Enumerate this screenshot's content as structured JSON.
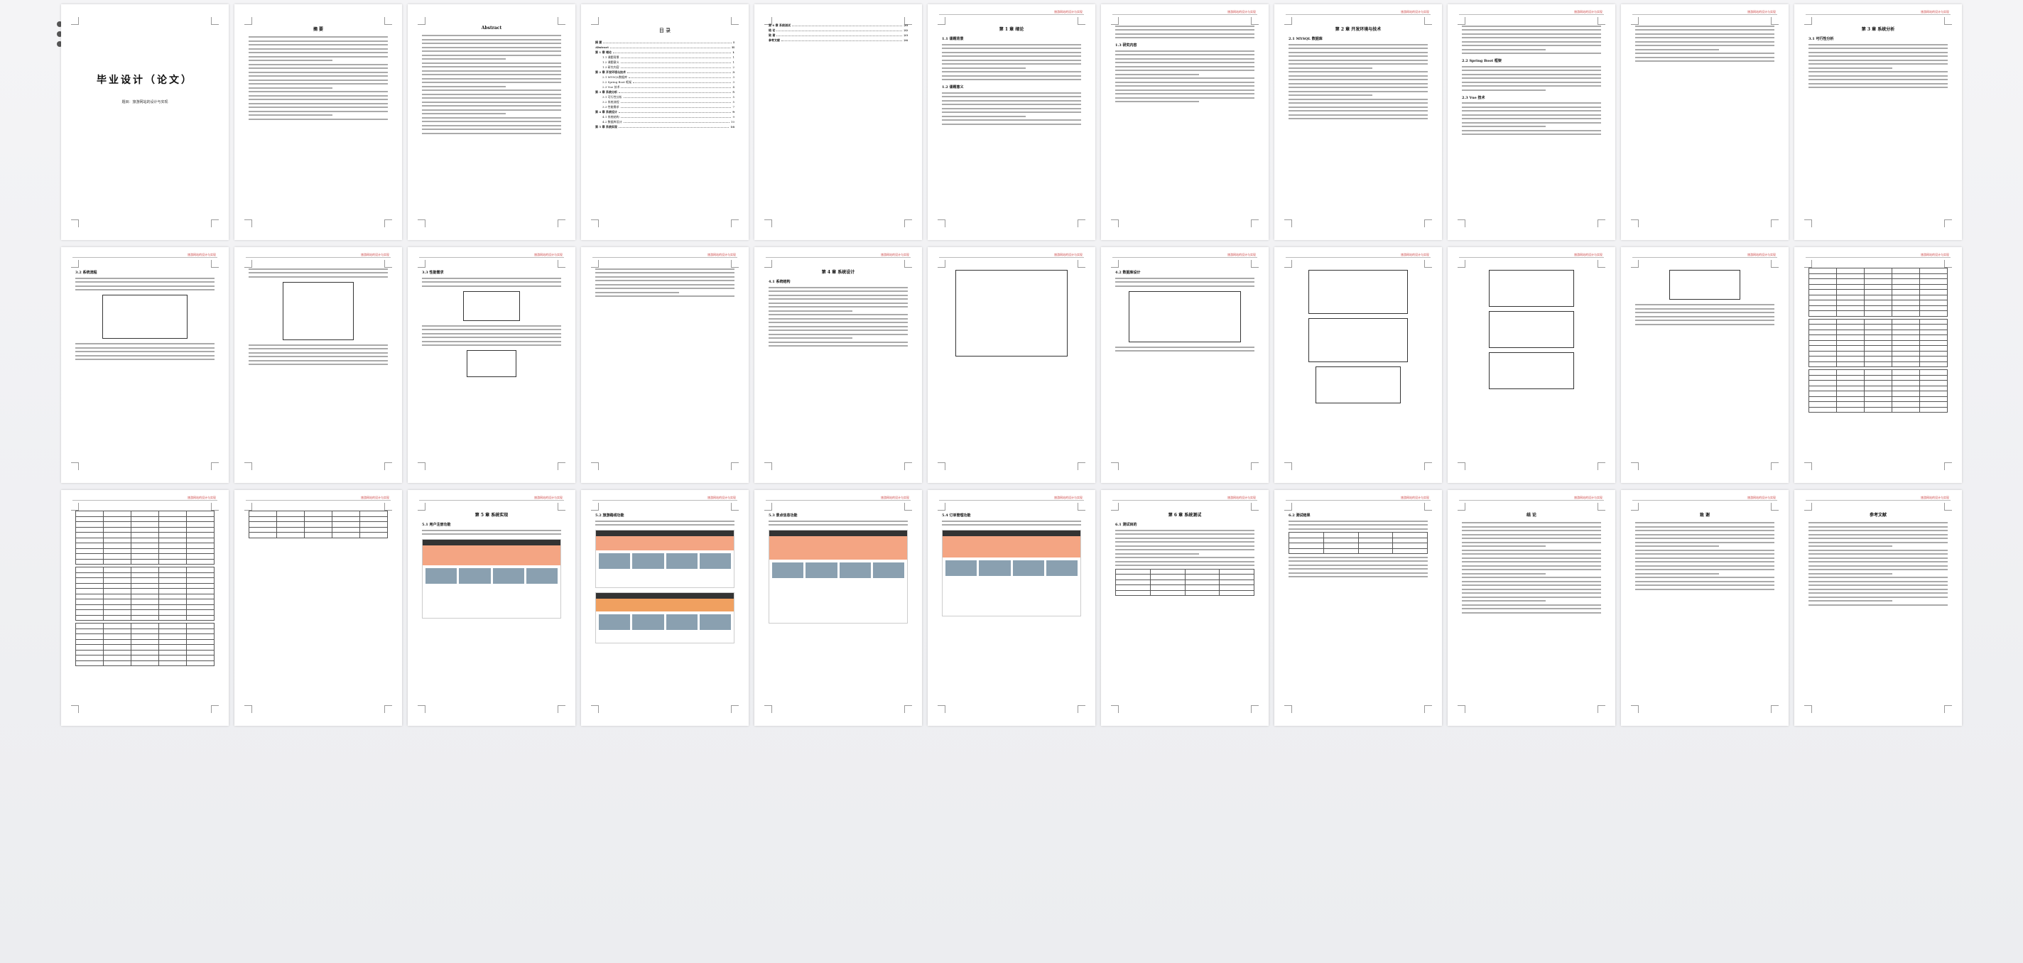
{
  "document": {
    "cover_title": "毕业设计（论文）",
    "cover_subtitle": "题目：旅游网站的设计与实现",
    "abstract_cn_title": "摘 要",
    "abstract_en_title": "Abstract",
    "toc_title": "目 录",
    "toc_entries": [
      {
        "label": "摘 要",
        "page": "I",
        "level": 1
      },
      {
        "label": "Abstract",
        "page": "II",
        "level": 1
      },
      {
        "label": "第 1 章 绪论",
        "page": "1",
        "level": 1
      },
      {
        "label": "1.1 课题背景",
        "page": "1",
        "level": 2
      },
      {
        "label": "1.2 课题意义",
        "page": "1",
        "level": 2
      },
      {
        "label": "1.3 研究内容",
        "page": "2",
        "level": 2
      },
      {
        "label": "第 2 章 开发环境与技术",
        "page": "3",
        "level": 1
      },
      {
        "label": "2.1 MYSQL数据库",
        "page": "3",
        "level": 2
      },
      {
        "label": "2.2 Spring Boot 框架",
        "page": "3",
        "level": 2
      },
      {
        "label": "2.3 Vue 技术",
        "page": "4",
        "level": 2
      },
      {
        "label": "第 3 章 系统分析",
        "page": "5",
        "level": 1
      },
      {
        "label": "3.1 可行性分析",
        "page": "5",
        "level": 2
      },
      {
        "label": "3.2 系统流程",
        "page": "5",
        "level": 2
      },
      {
        "label": "3.3 性能需求",
        "page": "7",
        "level": 2
      },
      {
        "label": "第 4 章 系统设计",
        "page": "9",
        "level": 1
      },
      {
        "label": "4.1 系统结构",
        "page": "9",
        "level": 2
      },
      {
        "label": "4.2 数据库设计",
        "page": "10",
        "level": 2
      },
      {
        "label": "第 5 章 系统实现",
        "page": "16",
        "level": 1
      },
      {
        "label": "第 6 章 系统测试",
        "page": "20",
        "level": 1
      },
      {
        "label": "结 论",
        "page": "22",
        "level": 1
      },
      {
        "label": "致 谢",
        "page": "23",
        "level": 1
      },
      {
        "label": "参考文献",
        "page": "24",
        "level": 1
      }
    ],
    "chapter_titles": [
      "第 1 章 绪论",
      "第 2 章 开发环境与技术",
      "第 3 章 系统分析",
      "第 4 章 系统设计",
      "第 5 章 系统实现",
      "第 6 章 系统测试",
      "结 论",
      "致 谢",
      "参考文献"
    ],
    "section_labels": {
      "s11": "1.1 课题背景",
      "s12": "1.2 课题意义",
      "s13": "1.3 研究内容",
      "s21": "2.1 MYSQL 数据库",
      "s22": "2.2 Spring Boot 框架",
      "s23": "2.3 Vue 技术",
      "s31": "3.1 可行性分析",
      "s32": "3.2 系统流程",
      "s33": "3.3 性能需求",
      "s41": "4.1 系统结构",
      "s42": "4.2 数据库设计",
      "s51": "5.1 用户注册功能",
      "s52": "5.2 旅游路线功能",
      "s53": "5.3 景点信息功能",
      "s54": "5.4 订单管理功能",
      "s61": "6.1 测试目的",
      "s62": "6.2 测试结果"
    },
    "running_header": "旅游网站的设计与实现"
  }
}
